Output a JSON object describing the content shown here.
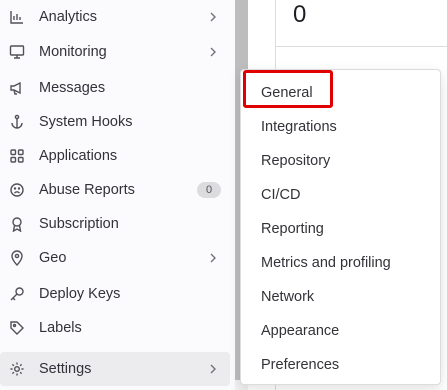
{
  "sidebar": {
    "items": [
      {
        "label": "Analytics",
        "icon": "analytics-icon",
        "has_chevron": true
      },
      {
        "label": "Monitoring",
        "icon": "monitor-icon",
        "has_chevron": true
      },
      {
        "label": "Messages",
        "icon": "megaphone-icon",
        "has_chevron": false
      },
      {
        "label": "System Hooks",
        "icon": "anchor-icon",
        "has_chevron": false
      },
      {
        "label": "Applications",
        "icon": "applications-icon",
        "has_chevron": false
      },
      {
        "label": "Abuse Reports",
        "icon": "abuse-icon",
        "has_chevron": false,
        "badge": "0"
      },
      {
        "label": "Subscription",
        "icon": "subscription-icon",
        "has_chevron": false
      },
      {
        "label": "Geo",
        "icon": "geo-pin-icon",
        "has_chevron": true
      },
      {
        "label": "Deploy Keys",
        "icon": "key-icon",
        "has_chevron": false
      },
      {
        "label": "Labels",
        "icon": "label-icon",
        "has_chevron": false
      },
      {
        "label": "Settings",
        "icon": "gear-icon",
        "has_chevron": true,
        "active": true
      }
    ]
  },
  "main": {
    "stat_value": "0"
  },
  "flyout": {
    "items": [
      {
        "label": "General",
        "highlighted": true
      },
      {
        "label": "Integrations"
      },
      {
        "label": "Repository"
      },
      {
        "label": "CI/CD"
      },
      {
        "label": "Reporting"
      },
      {
        "label": "Metrics and profiling"
      },
      {
        "label": "Network"
      },
      {
        "label": "Appearance"
      },
      {
        "label": "Preferences"
      }
    ]
  },
  "colors": {
    "sidebar_bg": "#fbfafd",
    "active_bg": "#ececef",
    "highlight_border": "#e00000",
    "text": "#333238"
  }
}
